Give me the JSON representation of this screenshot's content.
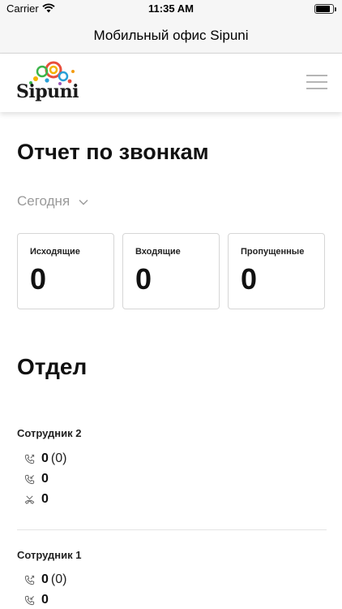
{
  "status_bar": {
    "carrier": "Carrier",
    "time": "11:35 AM",
    "battery_level": 0.85
  },
  "nav": {
    "title": "Мобильный офис Sipuni"
  },
  "header": {
    "logo_text": "Sipuni",
    "menu_icon": "hamburger-menu-icon"
  },
  "report": {
    "title": "Отчет по звонкам",
    "period": "Сегодня",
    "cards": [
      {
        "label": "Исходящие",
        "value": "0"
      },
      {
        "label": "Входящие",
        "value": "0"
      },
      {
        "label": "Пропущенные",
        "value": "0"
      }
    ]
  },
  "department": {
    "title": "Отдел",
    "employees": [
      {
        "name": "Сотрудник 2",
        "stats": [
          {
            "icon": "outgoing-call-icon",
            "value": "0",
            "extra": "(0)"
          },
          {
            "icon": "incoming-call-icon",
            "value": "0"
          },
          {
            "icon": "missed-call-icon",
            "value": "0"
          }
        ]
      },
      {
        "name": "Сотрудник 1",
        "stats": [
          {
            "icon": "outgoing-call-icon",
            "value": "0",
            "extra": "(0)"
          },
          {
            "icon": "incoming-call-icon",
            "value": "0"
          }
        ]
      }
    ]
  },
  "colors": {
    "accent_gray": "#9a9a9a",
    "border": "#d6d6d6",
    "text": "#111111"
  }
}
